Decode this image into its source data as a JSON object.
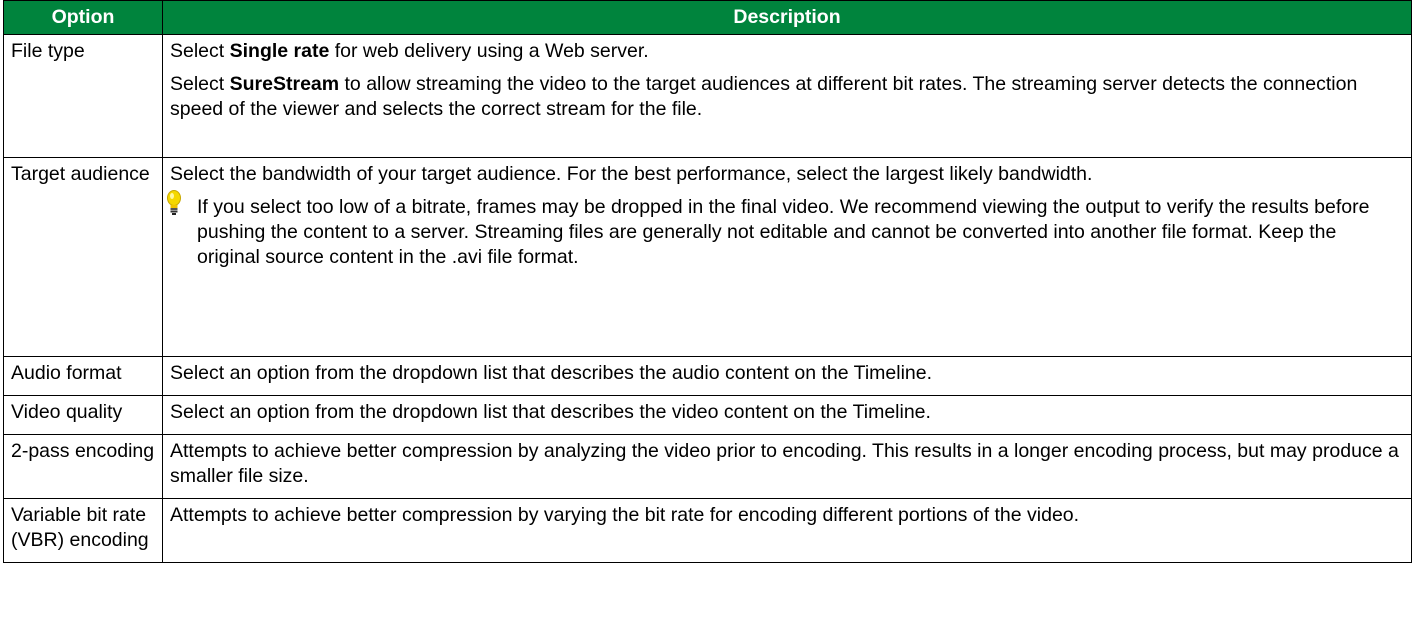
{
  "header": {
    "option": "Option",
    "description": "Description"
  },
  "rows": [
    {
      "option": "File type",
      "paras": [
        {
          "pre": "Select ",
          "bold": "Single rate",
          "post": " for web delivery using a Web server."
        },
        {
          "pre": "Select ",
          "bold": "SureStream",
          "post": " to allow streaming the video to the target audiences at different bit rates. The streaming server detects the connection speed of the viewer and selects the correct stream for the file."
        }
      ]
    },
    {
      "option": "Target audience",
      "text": "Select the bandwidth of your target audience. For the best performance, select the largest likely bandwidth.",
      "tip": "If you select too low of a bitrate, frames may be dropped in the final video. We recommend viewing the output to verify the results before pushing the content to a server. Streaming files are generally not editable and cannot be converted into another file format. Keep the original source content in the .avi file format.",
      "tip_icon": "lightbulb-icon"
    },
    {
      "option": "Audio format",
      "text": "Select an option from the dropdown list that describes the audio content on the Timeline."
    },
    {
      "option": "Video quality",
      "text": "Select an option from the dropdown list that describes the video content on the Timeline."
    },
    {
      "option": "2-pass encoding",
      "text": "Attempts to achieve better compression by analyzing the video prior to encoding. This results in a longer encoding process, but may produce a smaller file size."
    },
    {
      "option": "Variable bit rate (VBR) encoding",
      "text": "Attempts to achieve better compression by varying the bit rate for encoding different portions of the video."
    }
  ],
  "colors": {
    "header_bg": "#00843d",
    "header_text": "#ffffff",
    "border": "#000000",
    "bulb": "#f5d800"
  }
}
